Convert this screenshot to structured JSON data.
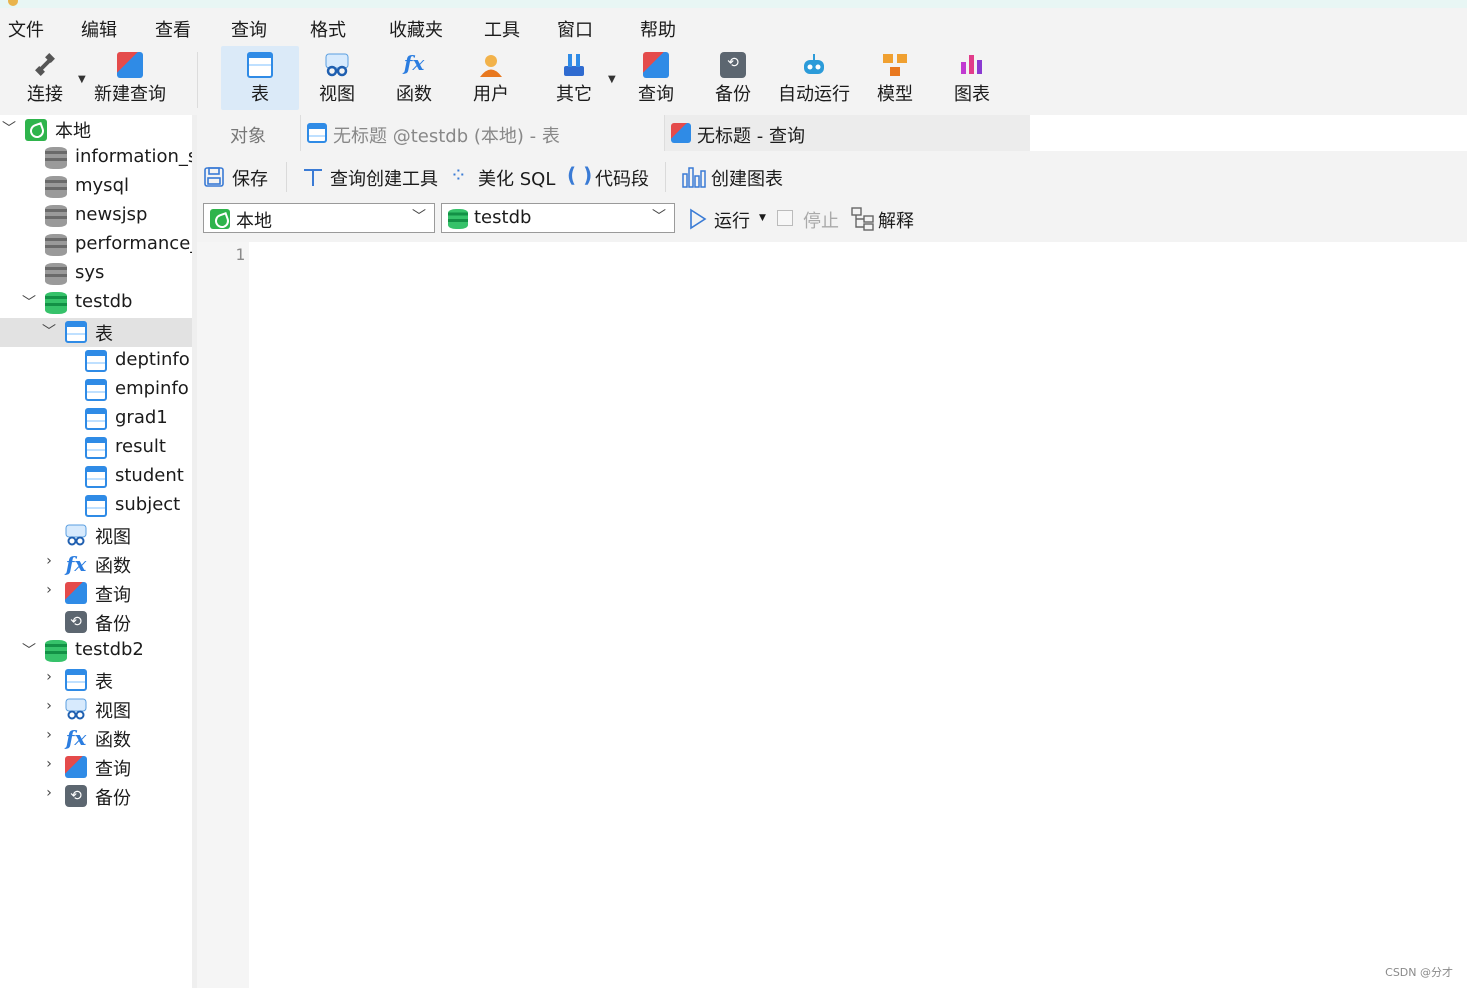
{
  "menu": [
    "文件",
    "编辑",
    "查看",
    "查询",
    "格式",
    "收藏夹",
    "工具",
    "窗口",
    "帮助"
  ],
  "toolbar": {
    "connect": "连接",
    "new_query": "新建查询",
    "table": "表",
    "view": "视图",
    "function": "函数",
    "user": "用户",
    "other": "其它",
    "query": "查询",
    "backup": "备份",
    "auto_run": "自动运行",
    "model": "模型",
    "chart": "图表"
  },
  "sidebar": {
    "connection": "本地",
    "databases": [
      "information_s",
      "mysql",
      "newsjsp",
      "performance_",
      "sys"
    ],
    "testdb": {
      "name": "testdb",
      "tables_label": "表",
      "tables": [
        "deptinfo",
        "empinfo",
        "grad1",
        "result",
        "student",
        "subject"
      ],
      "views": "视图",
      "functions": "函数",
      "queries": "查询",
      "backups": "备份"
    },
    "testdb2": {
      "name": "testdb2",
      "tables": "表",
      "views": "视图",
      "functions": "函数",
      "queries": "查询",
      "backups": "备份"
    }
  },
  "tabs": {
    "objects": "对象",
    "table_tab": "无标题 @testdb (本地) - 表",
    "query_tab": "无标题 - 查询"
  },
  "editor_toolbar": {
    "save": "保存",
    "query_builder": "查询创建工具",
    "beautify": "美化 SQL",
    "snippet": "代码段",
    "create_chart": "创建图表",
    "connection_value": "本地",
    "database_value": "testdb",
    "run": "运行",
    "stop": "停止",
    "explain": "解释"
  },
  "editor": {
    "line_number": "1"
  },
  "watermark": "CSDN @分才",
  "colors": {
    "accent": "#2f8be6",
    "active_tool": "#dbeaf8",
    "selected_row": "#e2e2e2",
    "db_green": "#139146"
  }
}
